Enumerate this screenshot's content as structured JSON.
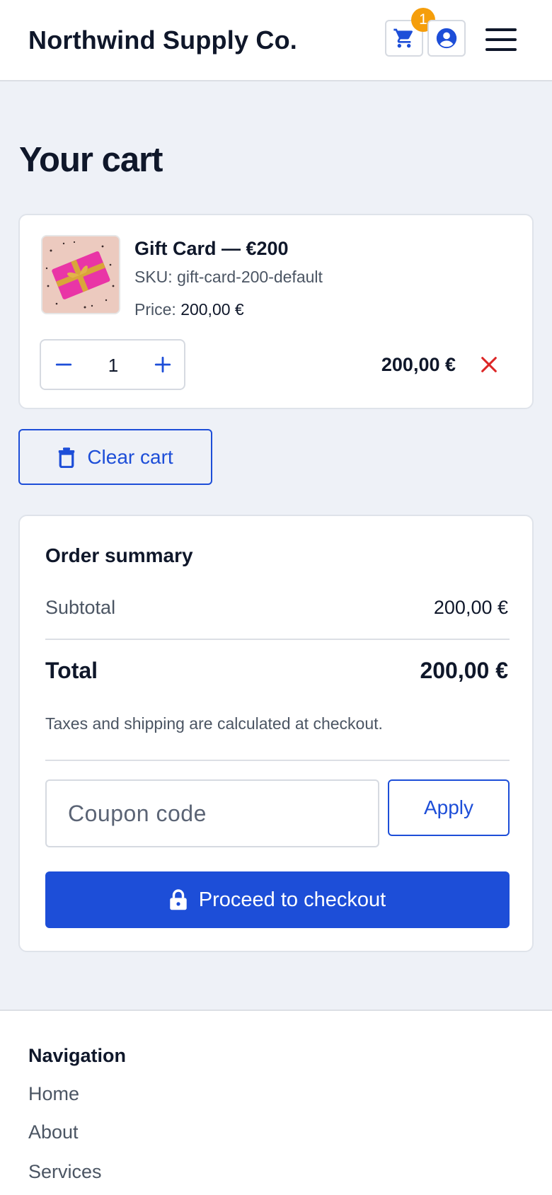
{
  "header": {
    "brand": "Northwind Supply Co.",
    "cart_count": "1",
    "icons": [
      "cart-icon",
      "account-icon",
      "hamburger-menu-icon"
    ]
  },
  "page": {
    "title": "Your cart"
  },
  "cart": {
    "item": {
      "name": "Gift Card — €200",
      "sku_label": "SKU: gift-card-200-default",
      "price_label": "Price:",
      "price_value": "200,00 €",
      "quantity": "1",
      "line_total": "200,00 €"
    },
    "clear_label": "Clear cart"
  },
  "summary": {
    "title": "Order summary",
    "subtotal_label": "Subtotal",
    "subtotal_value": "200,00 €",
    "total_label": "Total",
    "total_value": "200,00 €",
    "tax_note": "Taxes and shipping are calculated at checkout.",
    "coupon_placeholder": "Coupon code",
    "apply_label": "Apply",
    "checkout_label": "Proceed to checkout"
  },
  "footer": {
    "title": "Navigation",
    "links": [
      "Home",
      "About",
      "Services"
    ]
  },
  "colors": {
    "accent": "#1d4ed8",
    "badge": "#f59e0b",
    "danger": "#dc2626",
    "page_bg": "#eef1f7"
  }
}
